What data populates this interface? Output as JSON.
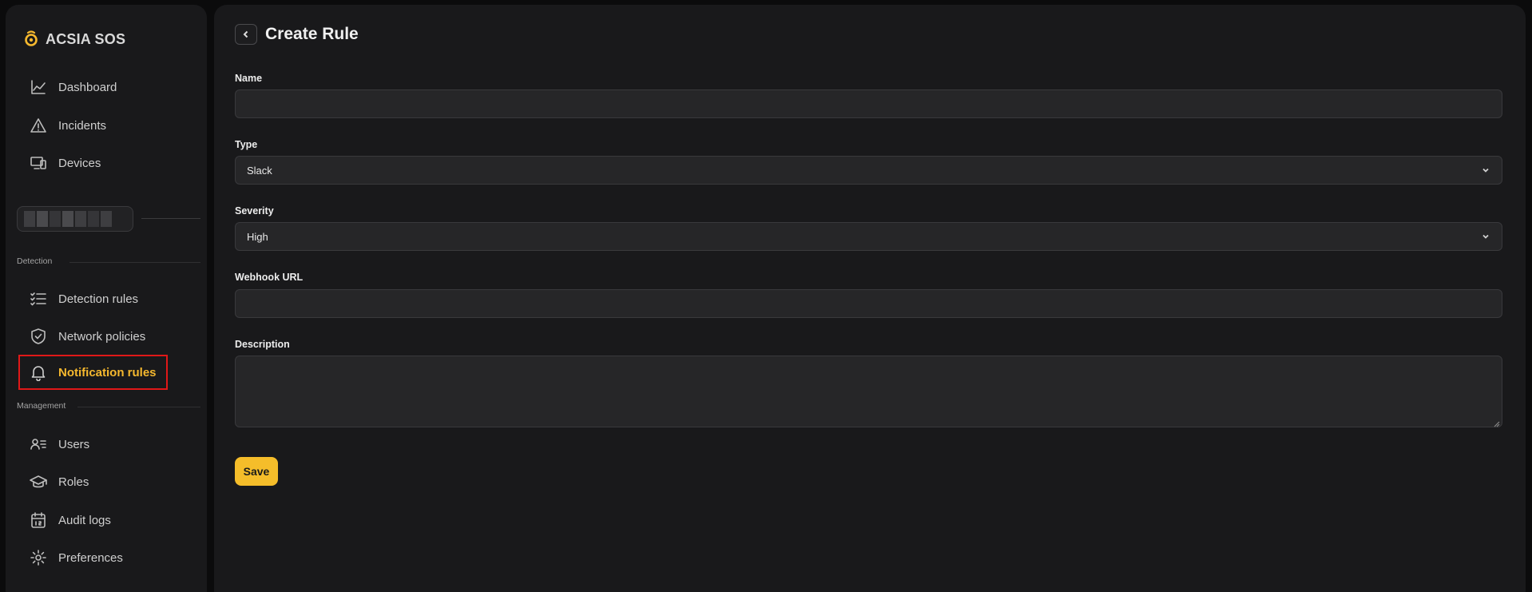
{
  "brand": {
    "name": "ACSIA SOS",
    "logo_color": "#f5b82e"
  },
  "sidebar": {
    "primary": [
      {
        "label": "Dashboard",
        "icon": "chart-line-icon"
      },
      {
        "label": "Incidents",
        "icon": "warning-triangle-icon"
      },
      {
        "label": "Devices",
        "icon": "devices-icon"
      }
    ],
    "sections": {
      "detection": "Detection",
      "management": "Management"
    },
    "detection_items": [
      {
        "label": "Detection rules",
        "icon": "checklist-icon"
      },
      {
        "label": "Network policies",
        "icon": "shield-check-icon"
      },
      {
        "label": "Notification rules",
        "icon": "bell-icon",
        "active": true
      }
    ],
    "management_items": [
      {
        "label": "Users",
        "icon": "users-list-icon"
      },
      {
        "label": "Roles",
        "icon": "graduation-cap-icon"
      },
      {
        "label": "Audit logs",
        "icon": "calendar-icon"
      },
      {
        "label": "Preferences",
        "icon": "gear-icon"
      }
    ]
  },
  "main": {
    "title": "Create Rule",
    "form": {
      "name_label": "Name",
      "name_value": "",
      "type_label": "Type",
      "type_value": "Slack",
      "severity_label": "Severity",
      "severity_value": "High",
      "webhook_label": "Webhook URL",
      "webhook_value": "",
      "description_label": "Description",
      "description_value": "",
      "save_label": "Save"
    }
  },
  "colors": {
    "accent": "#f5b82e",
    "active_outline": "#e01818",
    "panel": "#19191b",
    "background": "#0b0b0c"
  }
}
